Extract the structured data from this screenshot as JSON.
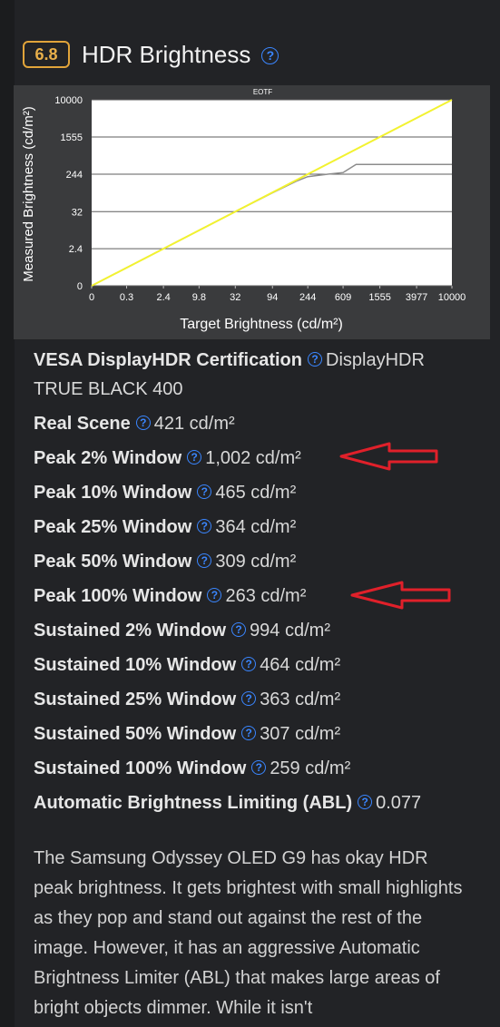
{
  "section": {
    "score": "6.8",
    "title": "HDR Brightness",
    "help_glyph": "?"
  },
  "chart_data": {
    "type": "line",
    "title": "EOTF",
    "xlabel": "Target Brightness (cd/m²)",
    "ylabel": "Measured Brightness (cd/m²)",
    "x_ticks": [
      "0",
      "0.3",
      "2.4",
      "9.8",
      "32",
      "94",
      "244",
      "609",
      "1555",
      "3977",
      "10000"
    ],
    "y_ticks": [
      "0",
      "2.4",
      "32",
      "244",
      "1555",
      "10000"
    ],
    "x_scale": "PQ",
    "y_scale": "PQ",
    "xlim": [
      0,
      10000
    ],
    "ylim": [
      0,
      10000
    ],
    "grid": true,
    "series": [
      {
        "name": "",
        "color": "#f2f230",
        "x": [
          0,
          10000
        ],
        "y": [
          0,
          10000
        ]
      },
      {
        "name": "",
        "color": "#8c8c8c",
        "x": [
          0,
          0.3,
          2.4,
          9.8,
          32,
          94,
          180,
          244,
          420,
          609,
          850,
          1555,
          3977,
          10000
        ],
        "y": [
          0,
          0.3,
          2.4,
          9.8,
          32,
          92,
          170,
          215,
          245,
          265,
          400,
          400,
          400,
          400
        ]
      }
    ],
    "colors": {
      "background": "#3a3b3d",
      "plot": "#ffffff",
      "grid": "#5e5e5e"
    }
  },
  "specs": [
    {
      "label": "VESA DisplayHDR Certification",
      "value": "DisplayHDR TRUE BLACK 400"
    },
    {
      "label": "Real Scene",
      "value": "421 cd/m²"
    },
    {
      "label": "Peak 2% Window",
      "value": "1,002 cd/m²"
    },
    {
      "label": "Peak 10% Window",
      "value": "465 cd/m²"
    },
    {
      "label": "Peak 25% Window",
      "value": "364 cd/m²"
    },
    {
      "label": "Peak 50% Window",
      "value": "309 cd/m²"
    },
    {
      "label": "Peak 100% Window",
      "value": "263 cd/m²"
    },
    {
      "label": "Sustained 2% Window",
      "value": "994 cd/m²"
    },
    {
      "label": "Sustained 10% Window",
      "value": "464 cd/m²"
    },
    {
      "label": "Sustained 25% Window",
      "value": "363 cd/m²"
    },
    {
      "label": "Sustained 50% Window",
      "value": "307 cd/m²"
    },
    {
      "label": "Sustained 100% Window",
      "value": "259 cd/m²"
    },
    {
      "label": "Automatic Brightness Limiting (ABL)",
      "value": "0.077"
    }
  ],
  "description": "The Samsung Odyssey OLED G9 has okay HDR peak brightness. It gets brightest with small highlights as they pop and stand out against the rest of the image. However, it has an aggressive Automatic Brightness Limiter (ABL) that makes large areas of bright objects dimmer. While it isn't",
  "annotations": {
    "arrow_color": "#e0202a",
    "arrow_targets": [
      "Peak 2% Window",
      "Peak 100% Window"
    ]
  }
}
